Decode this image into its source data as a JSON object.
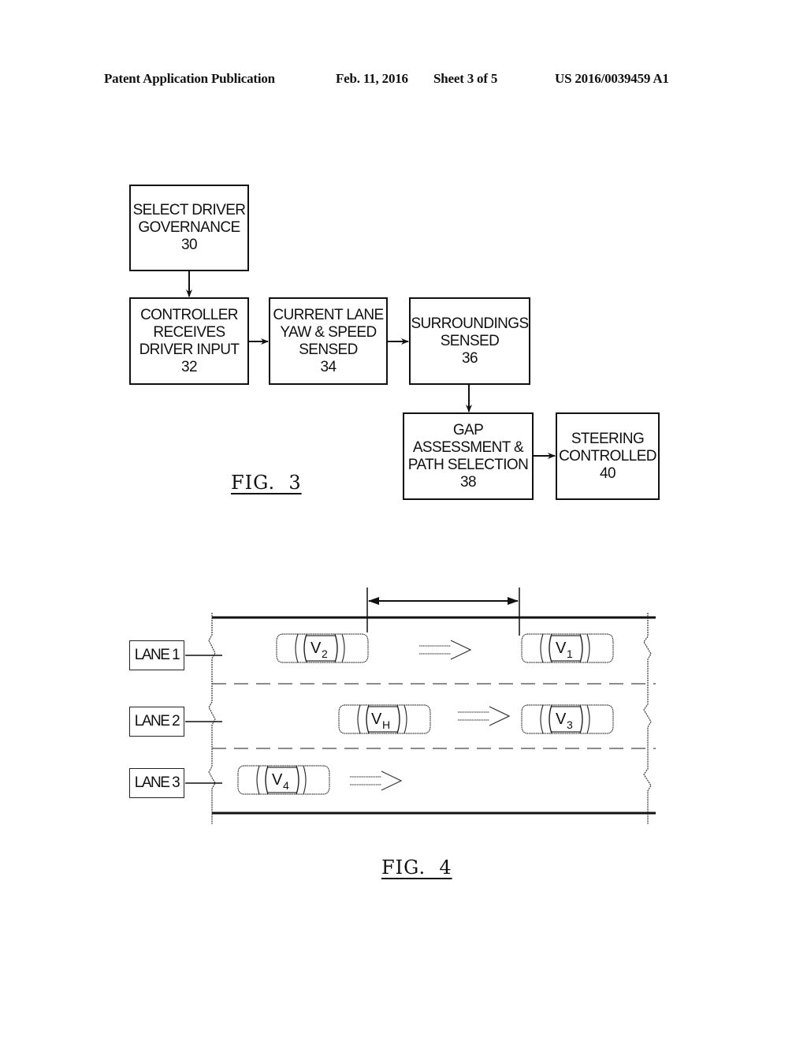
{
  "header": {
    "publication": "Patent Application Publication",
    "date": "Feb. 11, 2016",
    "sheet": "Sheet 3 of 5",
    "patent_number": "US 2016/0039459 A1"
  },
  "fig3": {
    "caption": "FIG.  3",
    "boxes": [
      {
        "id": "30",
        "lines": [
          "SELECT DRIVER",
          "GOVERNANCE",
          "30"
        ]
      },
      {
        "id": "32",
        "lines": [
          "CONTROLLER",
          "RECEIVES",
          "DRIVER  INPUT",
          "32"
        ]
      },
      {
        "id": "34",
        "lines": [
          "CURRENT LANE",
          "YAW & SPEED",
          "SENSED",
          "34"
        ]
      },
      {
        "id": "36",
        "lines": [
          "SURROUNDINGS",
          "SENSED",
          "36"
        ]
      },
      {
        "id": "38",
        "lines": [
          "GAP",
          "ASSESSMENT  &",
          "PATH SELECTION",
          "38"
        ]
      },
      {
        "id": "40",
        "lines": [
          "STEERING",
          "CONTROLLED",
          "40"
        ]
      }
    ],
    "flow": [
      [
        "30",
        "32"
      ],
      [
        "32",
        "34"
      ],
      [
        "34",
        "36"
      ],
      [
        "36",
        "38"
      ],
      [
        "38",
        "40"
      ]
    ]
  },
  "fig4": {
    "caption": "FIG.  4",
    "lanes": [
      "LANE 1",
      "LANE 2",
      "LANE 3"
    ],
    "vehicles": [
      {
        "label": "V",
        "sub": "2",
        "lane": 1
      },
      {
        "label": "V",
        "sub": "1",
        "lane": 1
      },
      {
        "label": "V",
        "sub": "H",
        "lane": 2
      },
      {
        "label": "V",
        "sub": "3",
        "lane": 2
      },
      {
        "label": "V",
        "sub": "4",
        "lane": 3
      }
    ],
    "direction": "right"
  }
}
